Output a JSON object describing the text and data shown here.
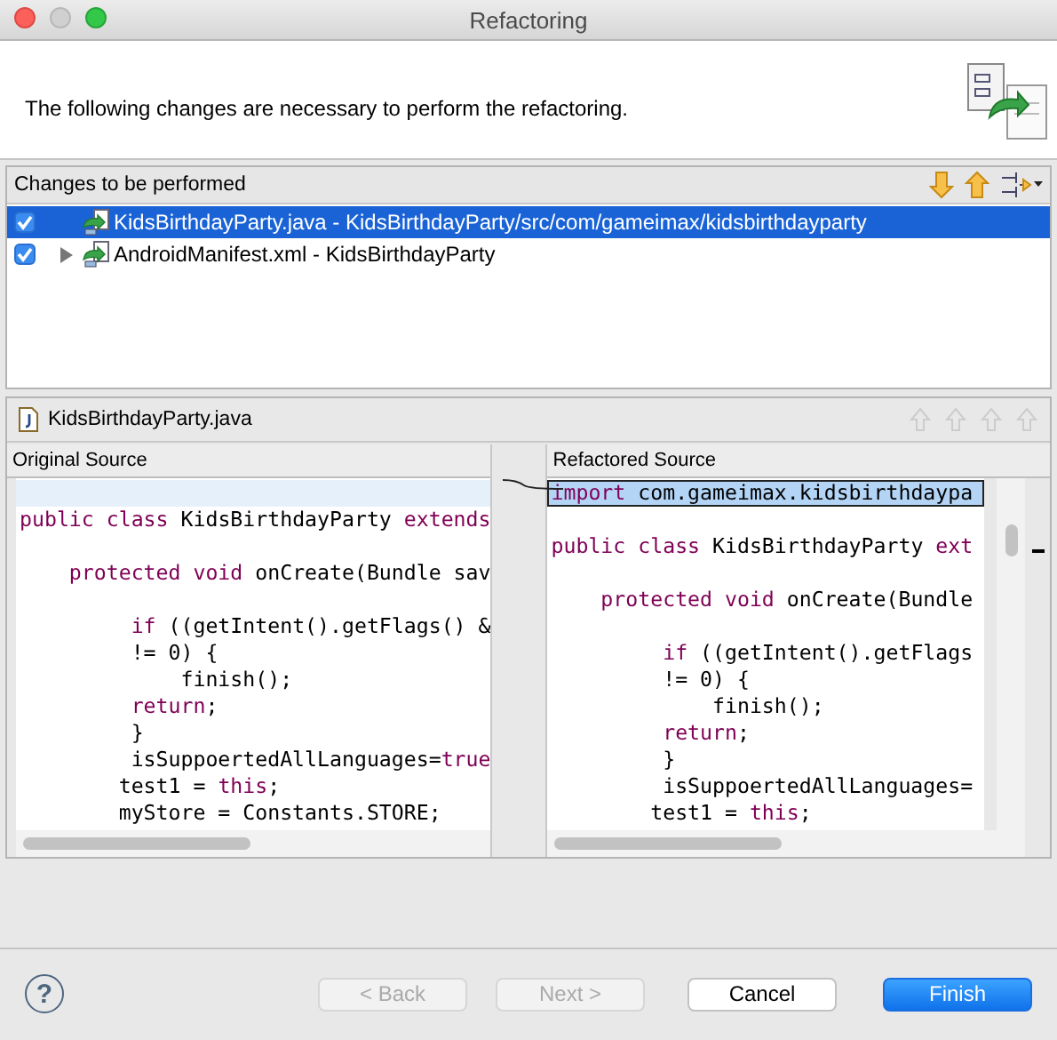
{
  "window": {
    "title": "Refactoring"
  },
  "header": {
    "message": "The following changes are necessary to perform the refactoring."
  },
  "changes": {
    "title": "Changes to be performed",
    "items": [
      {
        "label": "KidsBirthdayParty.java - KidsBirthdayParty/src/com/gameimax/kidsbirthdayparty",
        "checked": true,
        "selected": true,
        "expandable": false
      },
      {
        "label": "AndroidManifest.xml - KidsBirthdayParty",
        "checked": true,
        "selected": false,
        "expandable": true
      }
    ]
  },
  "compare": {
    "file": "KidsBirthdayParty.java",
    "panes": [
      {
        "title": "Original Source",
        "lines": [
          {
            "highlighted": true,
            "boxed": false
          },
          {
            "highlighted": false,
            "boxed": false,
            "segments": [
              {
                "kind": "keyword",
                "text": "public class "
              },
              {
                "kind": "code",
                "text": "KidsBirthdayParty "
              },
              {
                "kind": "keyword",
                "text": "extends"
              }
            ]
          },
          {
            "highlighted": false,
            "boxed": false
          },
          {
            "highlighted": false,
            "boxed": false,
            "segments": [
              {
                "kind": "keyword",
                "text": "    protected void "
              },
              {
                "kind": "code",
                "text": "onCreate(Bundle sav"
              }
            ]
          },
          {
            "highlighted": false,
            "boxed": false
          },
          {
            "highlighted": false,
            "boxed": false,
            "segments": [
              {
                "kind": "keyword",
                "text": "         if "
              },
              {
                "kind": "code",
                "text": "((getIntent().getFlags() &"
              }
            ]
          },
          {
            "highlighted": false,
            "boxed": false,
            "segments": [
              {
                "kind": "code",
                "text": "         != 0) {"
              }
            ]
          },
          {
            "highlighted": false,
            "boxed": false,
            "segments": [
              {
                "kind": "code",
                "text": "             finish();"
              }
            ]
          },
          {
            "highlighted": false,
            "boxed": false,
            "segments": [
              {
                "kind": "keyword",
                "text": "         return"
              },
              {
                "kind": "code",
                "text": ";"
              }
            ]
          },
          {
            "highlighted": false,
            "boxed": false,
            "segments": [
              {
                "kind": "code",
                "text": "         }"
              }
            ]
          },
          {
            "highlighted": false,
            "boxed": false,
            "segments": [
              {
                "kind": "code",
                "text": "         isSuppoertedAllLanguages="
              },
              {
                "kind": "keyword",
                "text": "true"
              }
            ]
          },
          {
            "highlighted": false,
            "boxed": false,
            "segments": [
              {
                "kind": "code",
                "text": "        test1 = "
              },
              {
                "kind": "keyword",
                "text": "this"
              },
              {
                "kind": "code",
                "text": ";"
              }
            ]
          },
          {
            "highlighted": false,
            "boxed": false,
            "segments": [
              {
                "kind": "code",
                "text": "        myStore = Constants.STORE;"
              }
            ]
          }
        ]
      },
      {
        "title": "Refactored Source",
        "lines": [
          {
            "highlighted": true,
            "boxed": true,
            "segments": [
              {
                "kind": "keyword",
                "text": "import "
              },
              {
                "kind": "code",
                "text": "com.gameimax.kidsbirthdaypa"
              }
            ]
          },
          {
            "highlighted": false,
            "boxed": false
          },
          {
            "highlighted": false,
            "boxed": false,
            "segments": [
              {
                "kind": "keyword",
                "text": "public class "
              },
              {
                "kind": "code",
                "text": "KidsBirthdayParty "
              },
              {
                "kind": "keyword",
                "text": "ext"
              }
            ]
          },
          {
            "highlighted": false,
            "boxed": false
          },
          {
            "highlighted": false,
            "boxed": false,
            "segments": [
              {
                "kind": "keyword",
                "text": "    protected void "
              },
              {
                "kind": "code",
                "text": "onCreate(Bundle"
              }
            ]
          },
          {
            "highlighted": false,
            "boxed": false
          },
          {
            "highlighted": false,
            "boxed": false,
            "segments": [
              {
                "kind": "keyword",
                "text": "         if "
              },
              {
                "kind": "code",
                "text": "((getIntent().getFlags"
              }
            ]
          },
          {
            "highlighted": false,
            "boxed": false,
            "segments": [
              {
                "kind": "code",
                "text": "         != 0) {"
              }
            ]
          },
          {
            "highlighted": false,
            "boxed": false,
            "segments": [
              {
                "kind": "code",
                "text": "             finish();"
              }
            ]
          },
          {
            "highlighted": false,
            "boxed": false,
            "segments": [
              {
                "kind": "keyword",
                "text": "         return"
              },
              {
                "kind": "code",
                "text": ";"
              }
            ]
          },
          {
            "highlighted": false,
            "boxed": false,
            "segments": [
              {
                "kind": "code",
                "text": "         }"
              }
            ]
          },
          {
            "highlighted": false,
            "boxed": false,
            "segments": [
              {
                "kind": "code",
                "text": "         isSuppoertedAllLanguages="
              }
            ]
          },
          {
            "highlighted": false,
            "boxed": false,
            "segments": [
              {
                "kind": "code",
                "text": "        test1 = "
              },
              {
                "kind": "keyword",
                "text": "this"
              },
              {
                "kind": "code",
                "text": ";"
              }
            ]
          }
        ]
      }
    ]
  },
  "footer": {
    "help": "?"
  },
  "buttons": [
    {
      "label": "< Back",
      "kind": "plain",
      "disabled": true
    },
    {
      "label": "Next >",
      "kind": "plain",
      "disabled": true
    },
    {
      "label": "Cancel",
      "kind": "plain",
      "disabled": false
    },
    {
      "label": "Finish",
      "kind": "default",
      "disabled": false
    }
  ]
}
